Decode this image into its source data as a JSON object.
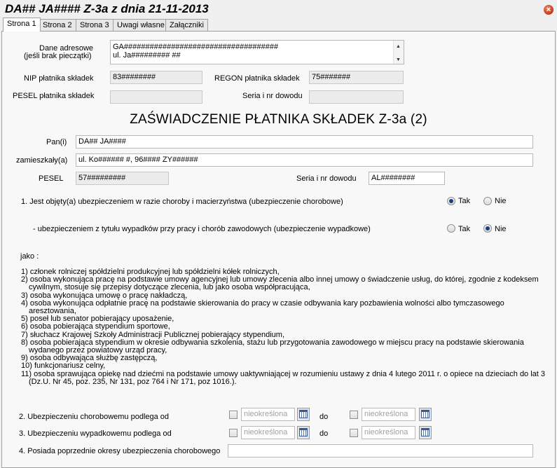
{
  "window": {
    "title": "DA## JA#### Z-3a z dnia 21-11-2013"
  },
  "tabs": [
    "Strona 1",
    "Strona 2",
    "Strona 3",
    "Uwagi własne",
    "Załączniki"
  ],
  "header_fields": {
    "address_label_1": "Dane adresowe",
    "address_label_2": "(jeśli brak pieczątki)",
    "address_line_1": "GA####################################",
    "address_line_2": "ul. Ja######### ##",
    "nip_label": "NIP płatnika składek",
    "nip_value": "83########",
    "regon_label": "REGON płatnika składek",
    "regon_value": "75#######",
    "pesel_payer_label": "PESEL płatnika składek",
    "pesel_payer_value": "",
    "id_doc_label": "Seria i nr dowodu",
    "id_doc_value": ""
  },
  "heading": "ZAŚWIADCZENIE PŁATNIKA SKŁADEK Z-3a (2)",
  "person": {
    "name_label": "Pan(i)",
    "name_value": "DA## JA####",
    "address_label": "zamieszkały(a)",
    "address_value": "ul. Ko###### #, 96#### ZY######",
    "pesel_label": "PESEL",
    "pesel_value": "57#########",
    "id_label": "Seria i nr dowodu",
    "id_value": "AL########"
  },
  "questions": {
    "q1_text": "1. Jest objęty(a) ubezpieczeniem w razie choroby i macierzyństwa (ubezpieczenie chorobowe)",
    "q1_selected": "Tak",
    "q1b_text": "- ubezpieczeniem z tytułu wypadków przy pracy i chorób zawodowych (ubezpieczenie wypadkowe)",
    "q1b_selected": "Nie",
    "yes_label": "Tak",
    "no_label": "Nie"
  },
  "jako_label": "jako :",
  "list_lines": [
    {
      "t": "1) członek rolniczej spółdzielni produkcyjnej lub spółdzielni kółek rolniczych,",
      "c": false
    },
    {
      "t": "2) osoba wykonująca pracę na podstawie umowy agencyjnej lub umowy zlecenia albo innej umowy o świadczenie usług, do której, zgodnie z kodeksem",
      "c": false
    },
    {
      "t": "cywilnym, stosuje się przepisy dotyczące zlecenia, lub jako osoba współpracująca,",
      "c": true
    },
    {
      "t": "3) osoba wykonująca umowę o pracę nakładczą,",
      "c": false
    },
    {
      "t": "4) osoba wykonująca odpłatnie pracę na podstawie skierowania do pracy w czasie odbywania kary pozbawienia wolności albo tymczasowego",
      "c": false
    },
    {
      "t": "aresztowania,",
      "c": true
    },
    {
      "t": "5) poseł lub senator pobierający uposażenie,",
      "c": false
    },
    {
      "t": "6) osoba pobierająca stypendium sportowe,",
      "c": false
    },
    {
      "t": "7)  słuchacz Krajowej Szkoły Administracji Publicznej pobierający stypendium,",
      "c": false
    },
    {
      "t": "8) osoba pobierająca stypendium w okresie odbywania szkolenia, stażu lub przygotowania zawodowego w miejscu pracy na podstawie skierowania",
      "c": false
    },
    {
      "t": "wydanego przez powiatowy urząd pracy,",
      "c": true
    },
    {
      "t": "9) osoba odbywająca służbę zastępczą,",
      "c": false
    },
    {
      "t": "10) funkcjonariusz celny,",
      "c": false
    },
    {
      "t": "11) osoba sprawująca opiekę nad dziećmi na podstawie umowy uaktywniającej w rozumieniu ustawy z dnia 4 lutego 2011 r. o opiece na dzieciach do lat 3",
      "c": false
    },
    {
      "t": "(Dz.U. Nr 45, poz. 235, Nr 131, poz 764 i Nr 171, poz 1016.).",
      "c": true
    }
  ],
  "periods": {
    "q2_label": "2.  Ubezpieczeniu chorobowemu podlega od",
    "q3_label": "3.  Ubezpieczeniu wypadkowemu podlega od",
    "q4_label": "4.  Posiada poprzednie okresy ubezpieczenia chorobowego",
    "date_placeholder": "nieokreślona",
    "do_label": "do",
    "q4_value": ""
  }
}
